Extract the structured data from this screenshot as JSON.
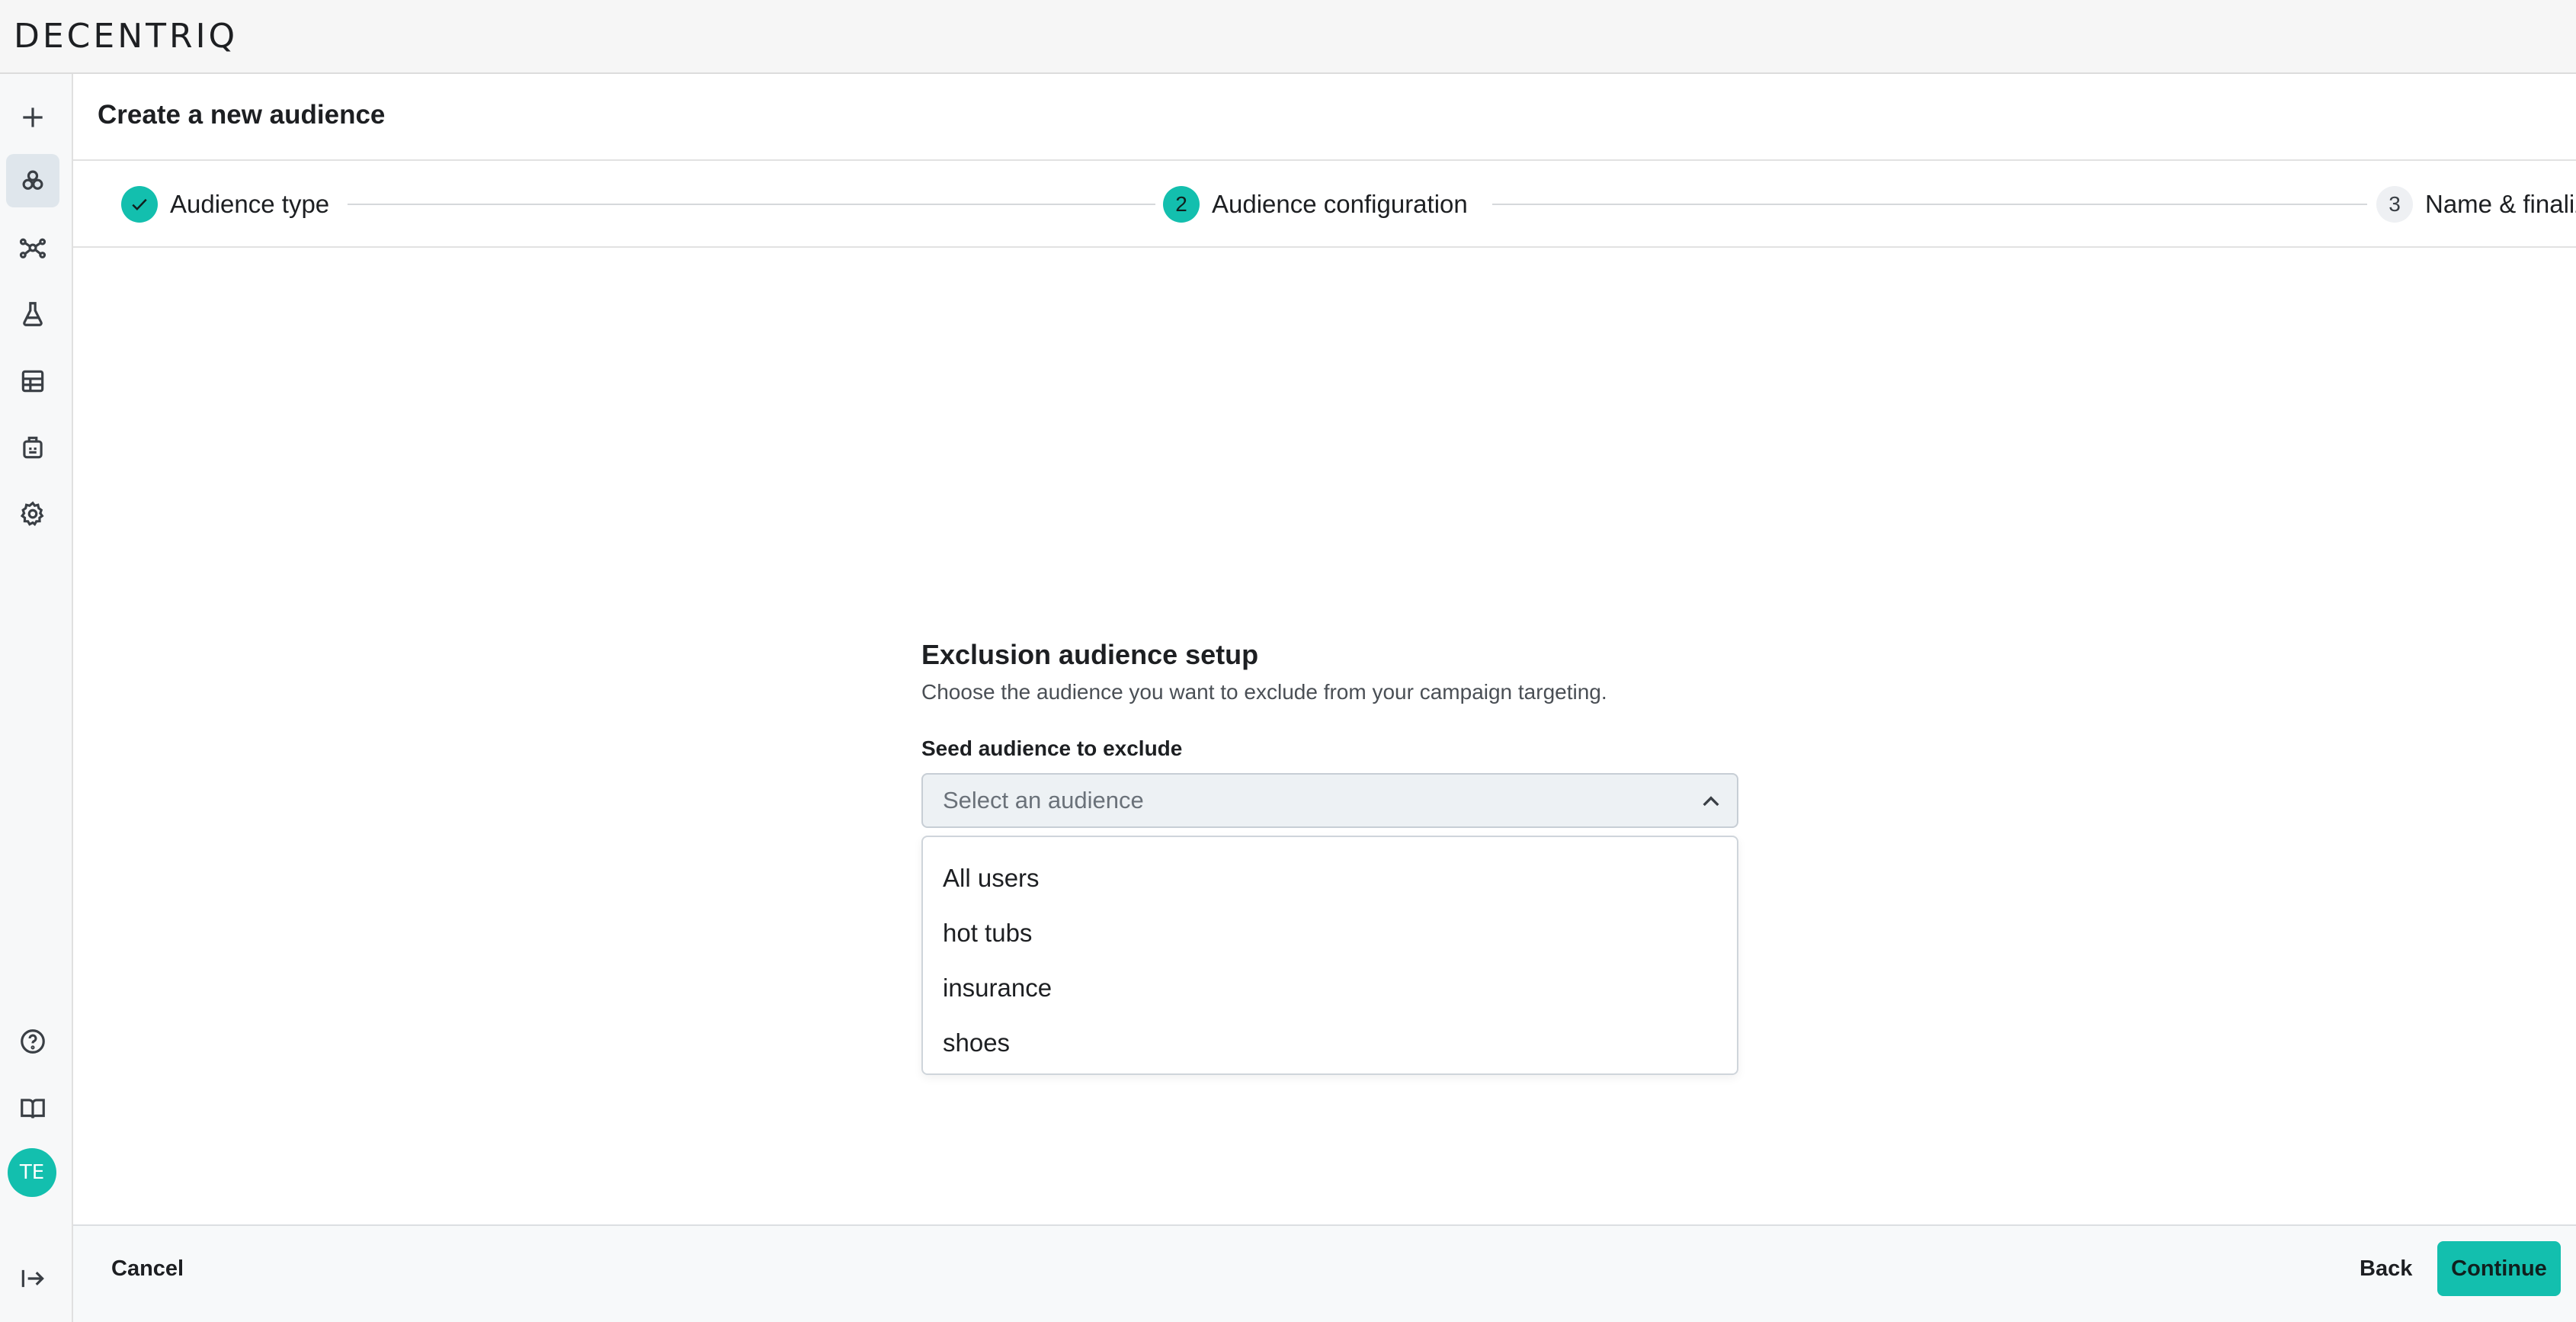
{
  "app": {
    "logo": "DECENTRIQ"
  },
  "sidebar": {
    "icons": [
      "plus-icon",
      "audiences-icon",
      "network-icon",
      "flask-icon",
      "table-icon",
      "datalab-icon",
      "gear-icon"
    ],
    "bottom_icons": [
      "help-icon",
      "book-icon"
    ],
    "avatar_initials": "TE",
    "collapse_icon": "collapse-sidebar-icon"
  },
  "header": {
    "title": "Create a new audience"
  },
  "stepper": {
    "steps": [
      {
        "number": "",
        "label": "Audience type",
        "state": "done"
      },
      {
        "number": "2",
        "label": "Audience configuration",
        "state": "current"
      },
      {
        "number": "3",
        "label": "Name & finalize",
        "state": "todo"
      }
    ]
  },
  "main": {
    "section_title": "Exclusion audience setup",
    "section_description": "Choose the audience you want to exclude from your campaign targeting.",
    "field_label": "Seed audience to exclude",
    "select_placeholder": "Select an audience",
    "options": [
      "All users",
      "hot tubs",
      "insurance",
      "shoes"
    ]
  },
  "footer": {
    "cancel_label": "Cancel",
    "back_label": "Back",
    "continue_label": "Continue"
  },
  "colors": {
    "accent": "#13bfae",
    "active_nav_bg": "#dfe6ec"
  }
}
